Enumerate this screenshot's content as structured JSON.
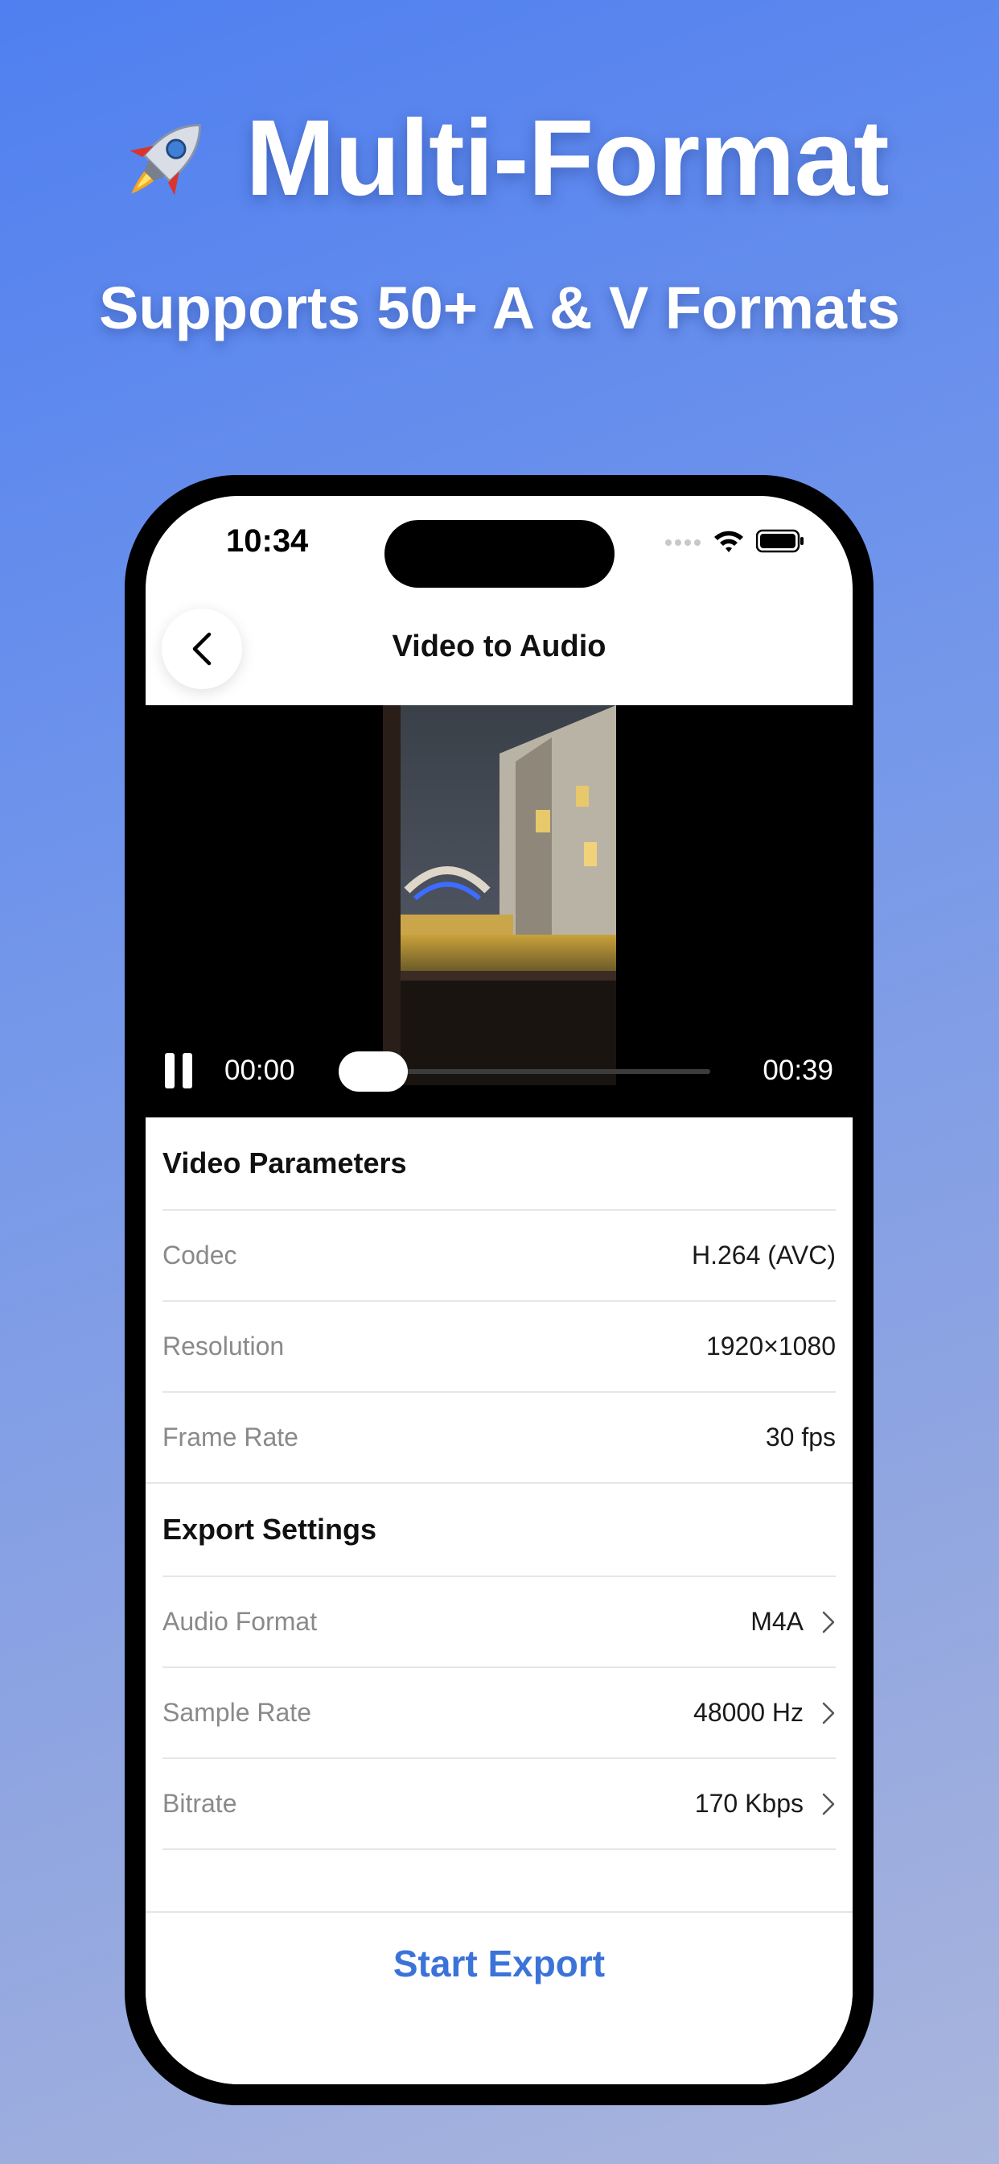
{
  "promo": {
    "title": "Multi-Format",
    "subtitle": "Supports 50+ A & V Formats",
    "icon": "rocket-icon"
  },
  "status_bar": {
    "time": "10:34"
  },
  "nav": {
    "title": "Video to Audio",
    "back_icon": "chevron-left-icon"
  },
  "player": {
    "current_time": "00:00",
    "total_time": "00:39",
    "progress": 0.0,
    "state": "playing"
  },
  "video_parameters": {
    "heading": "Video Parameters",
    "rows": [
      {
        "label": "Codec",
        "value": "H.264 (AVC)"
      },
      {
        "label": "Resolution",
        "value": "1920×1080"
      },
      {
        "label": "Frame Rate",
        "value": "30 fps"
      }
    ]
  },
  "export_settings": {
    "heading": "Export Settings",
    "rows": [
      {
        "label": "Audio Format",
        "value": "M4A"
      },
      {
        "label": "Sample Rate",
        "value": "48000 Hz"
      },
      {
        "label": "Bitrate",
        "value": "170 Kbps"
      }
    ]
  },
  "footer": {
    "start_label": "Start Export"
  },
  "colors": {
    "accent": "#3b73d9",
    "background_top": "#4f7ff0",
    "background_bottom": "#a9b5dc"
  }
}
